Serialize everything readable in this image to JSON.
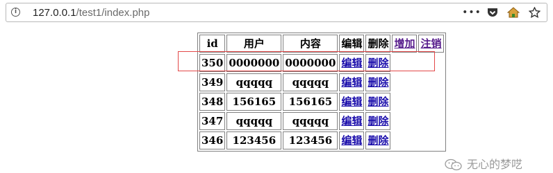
{
  "browser": {
    "url_host": "127.0.0.1",
    "url_path": "/test1/index.php",
    "icons": [
      "info-icon",
      "more-dots-icon",
      "pocket-icon",
      "home-icon",
      "star-icon"
    ]
  },
  "table": {
    "headers": {
      "id": "id",
      "user": "用户",
      "content": "内容",
      "edit": "编辑",
      "delete": "删除",
      "add_link": "增加",
      "logout_link": "注销"
    },
    "rows": [
      {
        "id": "350",
        "user": "0000000",
        "content": "0000000",
        "edit": "编辑",
        "delete": "删除"
      },
      {
        "id": "349",
        "user": "qqqqq",
        "content": "qqqqq",
        "edit": "编辑",
        "delete": "删除"
      },
      {
        "id": "348",
        "user": "156165",
        "content": "156165",
        "edit": "编辑",
        "delete": "删除"
      },
      {
        "id": "347",
        "user": "qqqqq",
        "content": "qqqqq",
        "edit": "编辑",
        "delete": "删除"
      },
      {
        "id": "346",
        "user": "123456",
        "content": "123456",
        "edit": "编辑",
        "delete": "删除"
      }
    ]
  },
  "watermark": {
    "text": "无心的梦呓"
  },
  "colors": {
    "link": "#1a0dab",
    "visited_link": "#551a8b",
    "highlight": "#e34848"
  }
}
